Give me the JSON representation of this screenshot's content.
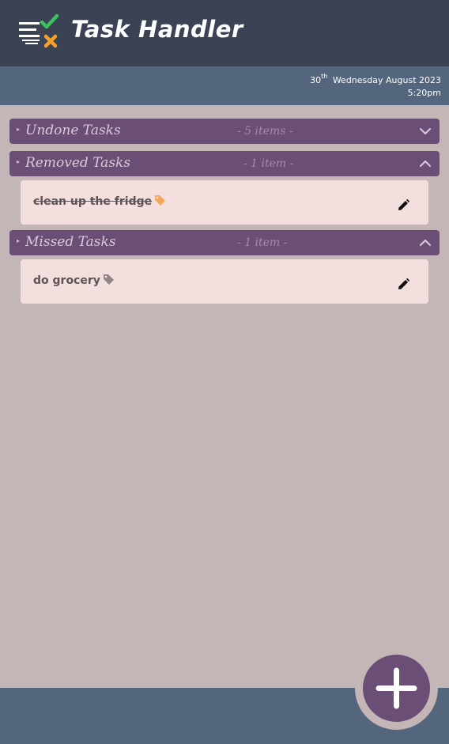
{
  "header": {
    "title": "Task Handler",
    "logo_icon": "task-list-check-cross-icon"
  },
  "date_bar": {
    "day": "30",
    "day_suffix": "th",
    "date_text": "Wednesday August 2023",
    "time": "5:20pm"
  },
  "sections": [
    {
      "title": "Undone Tasks",
      "count": "- 5 items -",
      "expanded": false,
      "tasks": []
    },
    {
      "title": "Removed Tasks",
      "count": "- 1 item -",
      "expanded": true,
      "tasks": [
        {
          "text": "clean up the fridge",
          "struck": true,
          "tag_color": "#f5a85a"
        }
      ]
    },
    {
      "title": "Missed Tasks",
      "count": "- 1 item -",
      "expanded": true,
      "tasks": [
        {
          "text": "do grocery",
          "struck": false,
          "tag_color": "#8f8589"
        }
      ]
    }
  ],
  "colors": {
    "header_bg": "#3a4254",
    "date_bar_bg": "#54667e",
    "section_bg": "#6a4e75",
    "card_bg": "#f4dfdf",
    "page_bg": "#c4b5b6",
    "check_green": "#3cc25a",
    "cross_orange": "#f5a02a"
  },
  "fab": {
    "icon": "plus-icon"
  }
}
